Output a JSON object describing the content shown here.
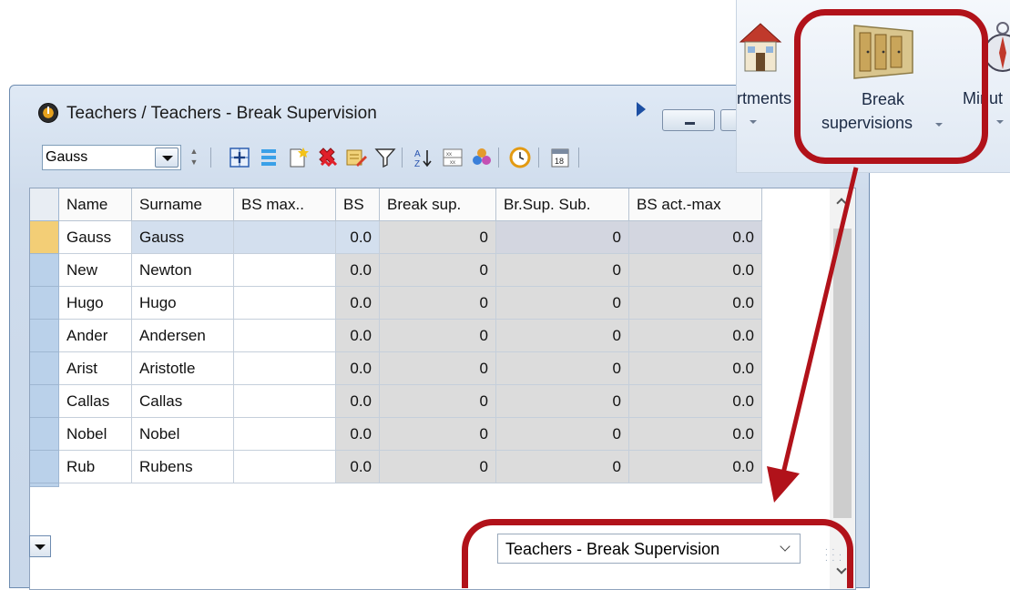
{
  "window": {
    "title": "Teachers / Teachers - Break Supervision"
  },
  "toolbar": {
    "combo_value": "Gauss"
  },
  "grid": {
    "columns": [
      "Name",
      "Surname",
      "BS max..",
      "BS",
      "Break sup.",
      "Br.Sup. Sub.",
      "BS act.-max"
    ],
    "rows": [
      [
        "Gauss",
        "Gauss",
        "",
        "0.0",
        "0",
        "0",
        "0.0"
      ],
      [
        "New",
        "Newton",
        "",
        "0.0",
        "0",
        "0",
        "0.0"
      ],
      [
        "Hugo",
        "Hugo",
        "",
        "0.0",
        "0",
        "0",
        "0.0"
      ],
      [
        "Ander",
        "Andersen",
        "",
        "0.0",
        "0",
        "0",
        "0.0"
      ],
      [
        "Arist",
        "Aristotle",
        "",
        "0.0",
        "0",
        "0",
        "0.0"
      ],
      [
        "Callas",
        "Callas",
        "",
        "0.0",
        "0",
        "0",
        "0.0"
      ],
      [
        "Nobel",
        "Nobel",
        "",
        "0.0",
        "0",
        "0",
        "0.0"
      ],
      [
        "Rub",
        "Rubens",
        "",
        "0.0",
        "0",
        "0",
        "0.0"
      ]
    ]
  },
  "bottom": {
    "view_select": "Teachers - Break Supervision"
  },
  "ribbon": {
    "departments_label": "rtments",
    "break_label_line1": "Break",
    "break_label_line2": "supervisions",
    "minutes_label": "Minut"
  },
  "colors": {
    "highlight": "#b1121a",
    "active_row_selector": "#f3ce76"
  }
}
